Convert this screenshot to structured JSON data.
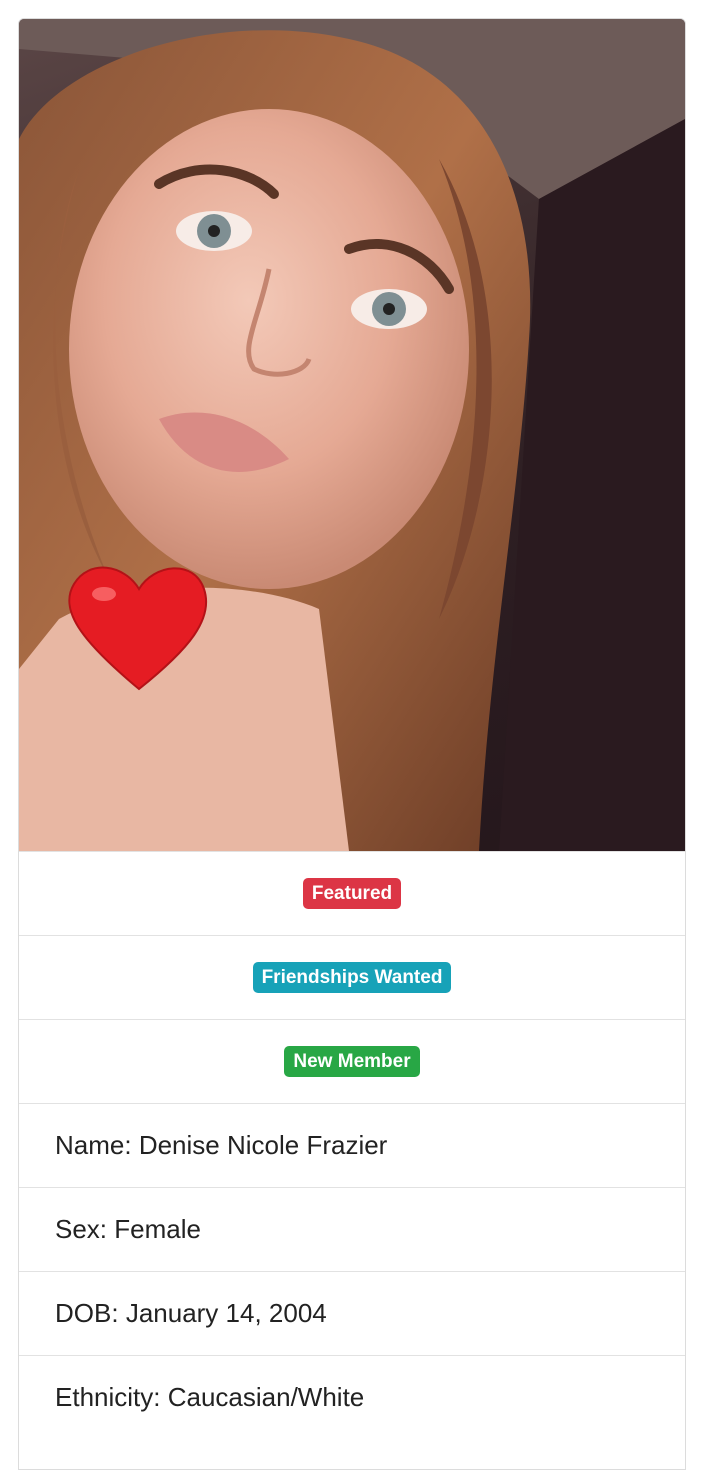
{
  "profile": {
    "badges": {
      "featured": "Featured",
      "friendships": "Friendships Wanted",
      "new_member": "New Member"
    },
    "fields": {
      "name_label": "Name:",
      "name_value": "Denise Nicole Frazier",
      "sex_label": "Sex:",
      "sex_value": "Female",
      "dob_label": "DOB:",
      "dob_value": "January 14, 2004",
      "ethnicity_label": "Ethnicity:",
      "ethnicity_value": "Caucasian/White"
    },
    "colors": {
      "featured": "#dc3545",
      "friendships": "#17a2b8",
      "new_member": "#28a745"
    },
    "photo_icon": "heart-emoji"
  }
}
